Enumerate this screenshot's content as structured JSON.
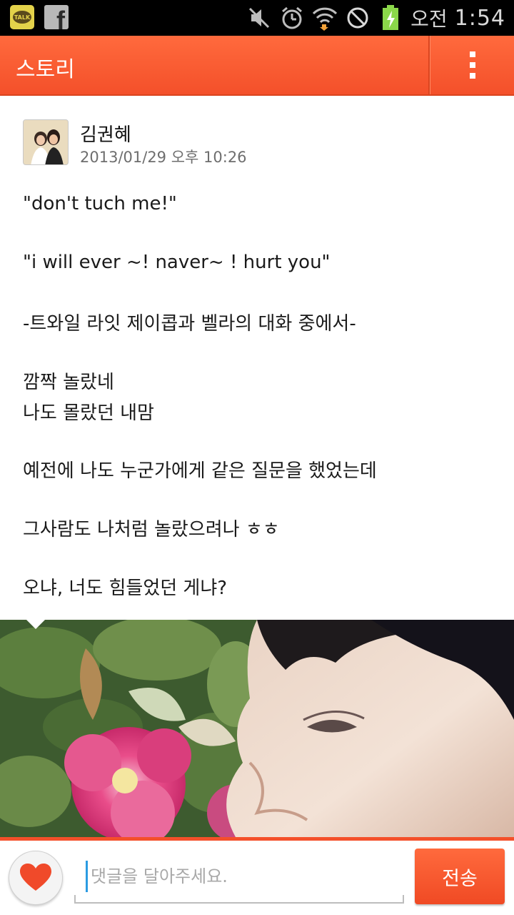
{
  "status_bar": {
    "ampm": "오전",
    "time": "1:54",
    "icons": [
      "kakaotalk-icon",
      "facebook-icon",
      "mute-icon",
      "alarm-icon",
      "wifi-icon",
      "blocked-icon",
      "battery-icon"
    ],
    "talk_label": "TALK"
  },
  "action_bar": {
    "title": "스토리",
    "menu_icon": "overflow-menu-icon"
  },
  "post": {
    "author": "김권혜",
    "date": "2013/01/29 오후 10:26",
    "lines": [
      "\"don't tuch me!\"",
      "\"i will ever ~! naver~ ! hurt you\"",
      "-트와일 라잇 제이콥과 벨라의 대화 중에서-",
      "깜짝 놀랐네",
      "나도 몰랐던 내맘",
      "예전에 나도 누군가에게 같은 질문을 했었는데",
      "그사람도 나처럼 놀랐으려나 ㅎㅎ",
      "오냐, 너도 힘들었던 게냐?"
    ]
  },
  "comment_bar": {
    "like_icon": "heart-icon",
    "placeholder": "댓글을 달아주세요.",
    "send_label": "전송"
  },
  "colors": {
    "accent": "#f4502a",
    "status_bar": "#000000",
    "text": "#1a1a1a",
    "meta_text": "#6e6e6e"
  }
}
